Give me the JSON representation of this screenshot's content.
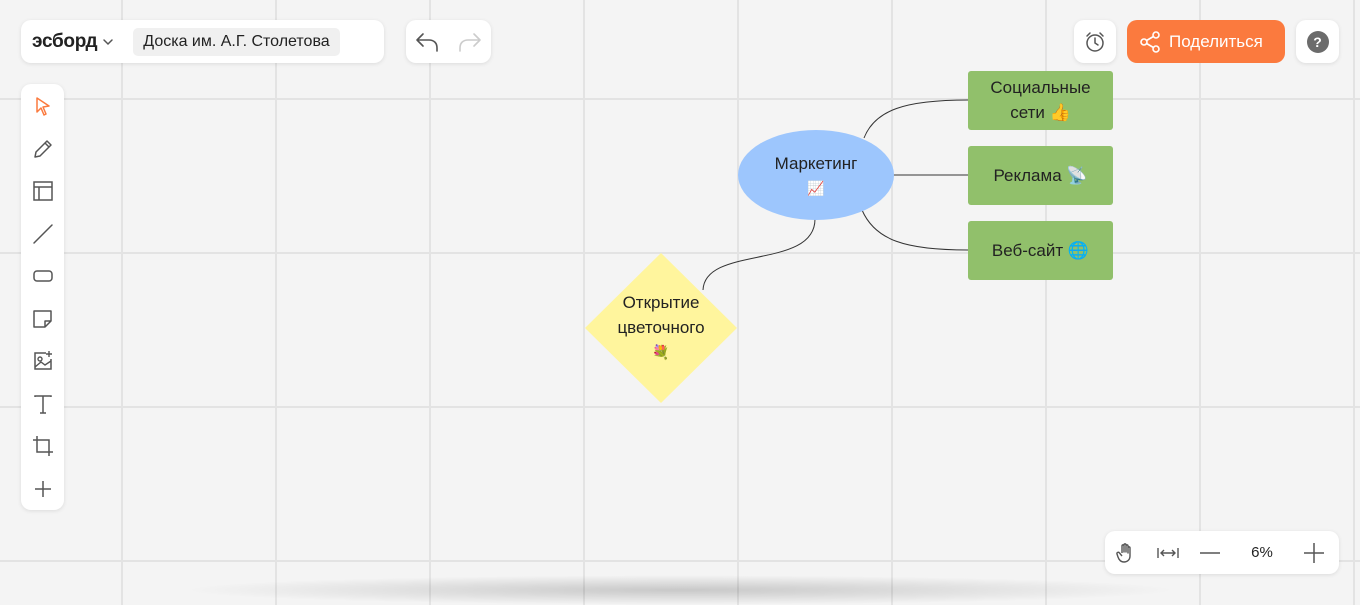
{
  "app": {
    "logo_text": "эсборд",
    "board_title": "Доска им. А.Г. Столетова"
  },
  "toolbar_top": {
    "share_label": "Поделиться",
    "help_label": "?",
    "icons": [
      "undo-icon",
      "redo-icon",
      "timer-icon",
      "share-icon",
      "help-icon"
    ]
  },
  "tools": [
    {
      "name": "select-icon",
      "active": true
    },
    {
      "name": "pen-icon"
    },
    {
      "name": "frame-icon"
    },
    {
      "name": "line-icon"
    },
    {
      "name": "shape-icon"
    },
    {
      "name": "sticky-note-icon"
    },
    {
      "name": "image-icon"
    },
    {
      "name": "text-icon"
    },
    {
      "name": "crop-icon"
    },
    {
      "name": "plus-icon"
    }
  ],
  "zoom": {
    "value": "6%",
    "icons": [
      "hand-icon",
      "fit-width-icon",
      "zoom-out-icon",
      "zoom-in-icon"
    ]
  },
  "mindmap": {
    "center": {
      "line1": "Маркетинг",
      "emoji": "📈",
      "color": "#9dc6fd"
    },
    "diamond": {
      "line1": "Открытие",
      "line2": "цветочного",
      "emoji": "💐",
      "color": "#fff59d"
    },
    "branches": [
      {
        "line1": "Социальные",
        "line2": "сети 👍",
        "color": "#91c06b"
      },
      {
        "line1": "Реклама 📡",
        "color": "#91c06b"
      },
      {
        "line1": "Веб-сайт 🌐",
        "color": "#91c06b"
      }
    ]
  },
  "colors": {
    "accent": "#fb7a3e",
    "active_tool": "#fb7a3e",
    "icon": "#555555"
  }
}
